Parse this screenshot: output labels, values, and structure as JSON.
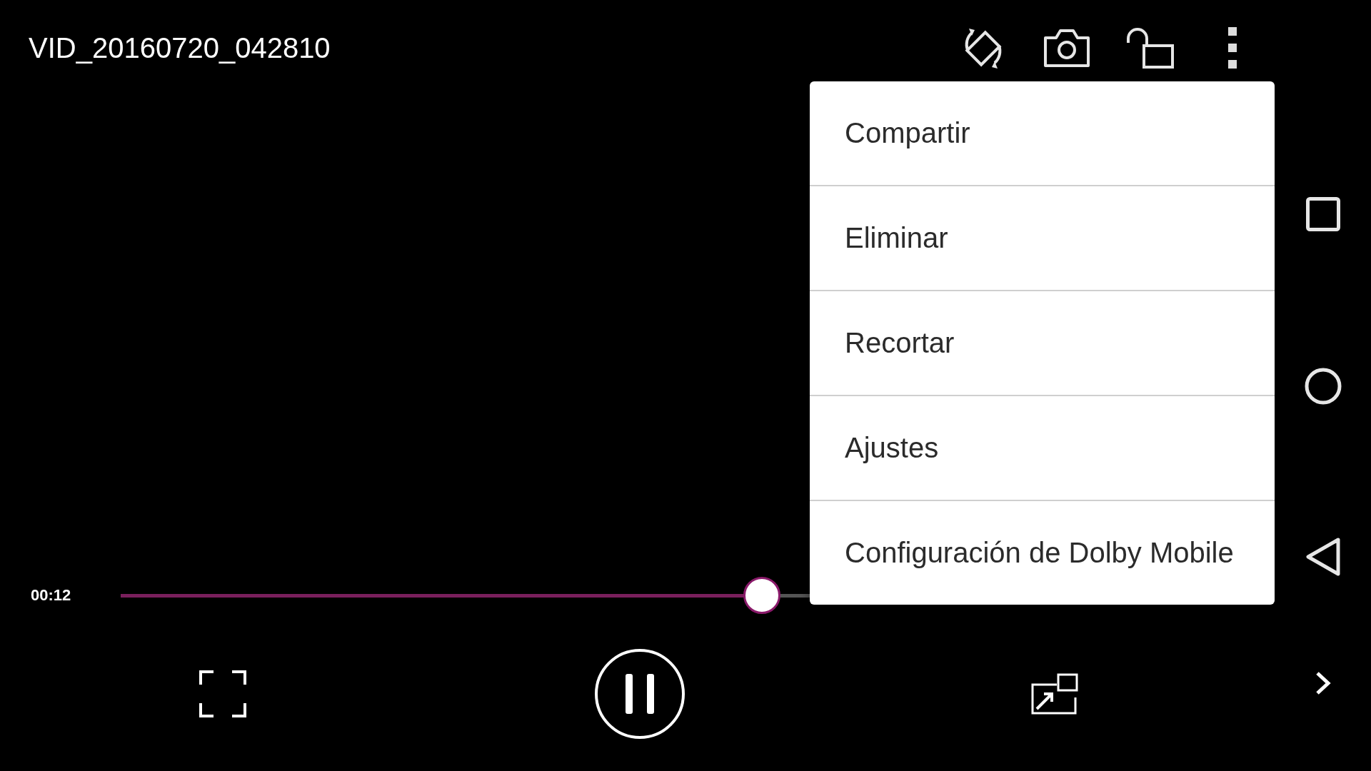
{
  "title": "VID_20160720_042810",
  "menu": {
    "items": [
      "Compartir",
      "Eliminar",
      "Recortar",
      "Ajustes",
      "Configuración de Dolby Mobile"
    ]
  },
  "playback": {
    "elapsed": "00:12",
    "level": 0.6,
    "playing": true
  }
}
